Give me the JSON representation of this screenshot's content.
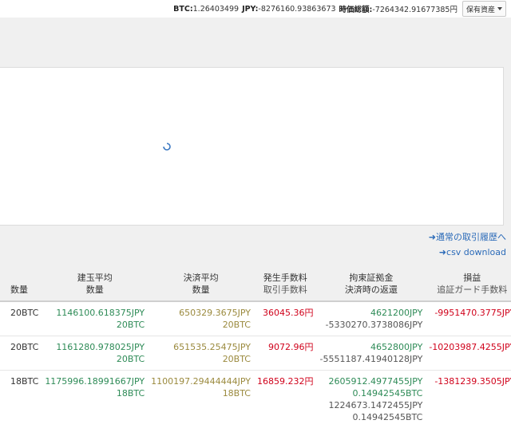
{
  "topbar": {
    "btc_label": "BTC:",
    "btc_value": "1.26403499",
    "jpy_label": "JPY:",
    "jpy_value": "-8276160.93863673",
    "total_label": "時価総額:",
    "total_value": "-7264342.91677385円",
    "holdings_dropdown": "保有資産"
  },
  "links": {
    "history": "通常の取引履歴へ",
    "csv": "csv download"
  },
  "table": {
    "headers": [
      {
        "line1": "",
        "line2": "数量"
      },
      {
        "line1": "建玉平均",
        "line2": "数量"
      },
      {
        "line1": "決済平均",
        "line2": "数量"
      },
      {
        "line1": "発生手数料",
        "line2": "取引手数料"
      },
      {
        "line1": "拘束証拠金",
        "line2": "決済時の返還"
      },
      {
        "line1": "損益",
        "line2": "追証ガード手数料"
      }
    ],
    "rows": [
      {
        "qty": "20BTC",
        "open_avg": "1146100.618375JPY",
        "open_qty": "20BTC",
        "close_avg": "650329.3675JPY",
        "close_qty": "20BTC",
        "fee": "36045.36円",
        "margin": [
          "4621200JPY",
          "-5330270.3738086JPY"
        ],
        "pnl": "-9951470.3775JPY"
      },
      {
        "qty": "20BTC",
        "open_avg": "1161280.978025JPY",
        "open_qty": "20BTC",
        "close_avg": "651535.25475JPY",
        "close_qty": "20BTC",
        "fee": "9072.96円",
        "margin": [
          "4652800JPY",
          "-5551187.41940128JPY"
        ],
        "pnl": "-10203987.4255JPY"
      },
      {
        "qty": "18BTC",
        "open_avg": "1175996.18991667JPY",
        "open_qty": "18BTC",
        "close_avg": "1100197.29444444JPY",
        "close_qty": "18BTC",
        "fee": "16859.232円",
        "margin": [
          "2605912.4977455JPY",
          "0.14942545BTC",
          "1224673.1472455JPY",
          "0.14942545BTC"
        ],
        "pnl": "-1381239.3505JPY"
      }
    ]
  },
  "colors": {
    "green": "#2e8b57",
    "olive": "#9b8a3e",
    "red": "#d0021b",
    "link": "#2a6ab8"
  },
  "icons": [
    "caret-down-icon",
    "loading-spinner-icon",
    "arrow-right-icon"
  ]
}
